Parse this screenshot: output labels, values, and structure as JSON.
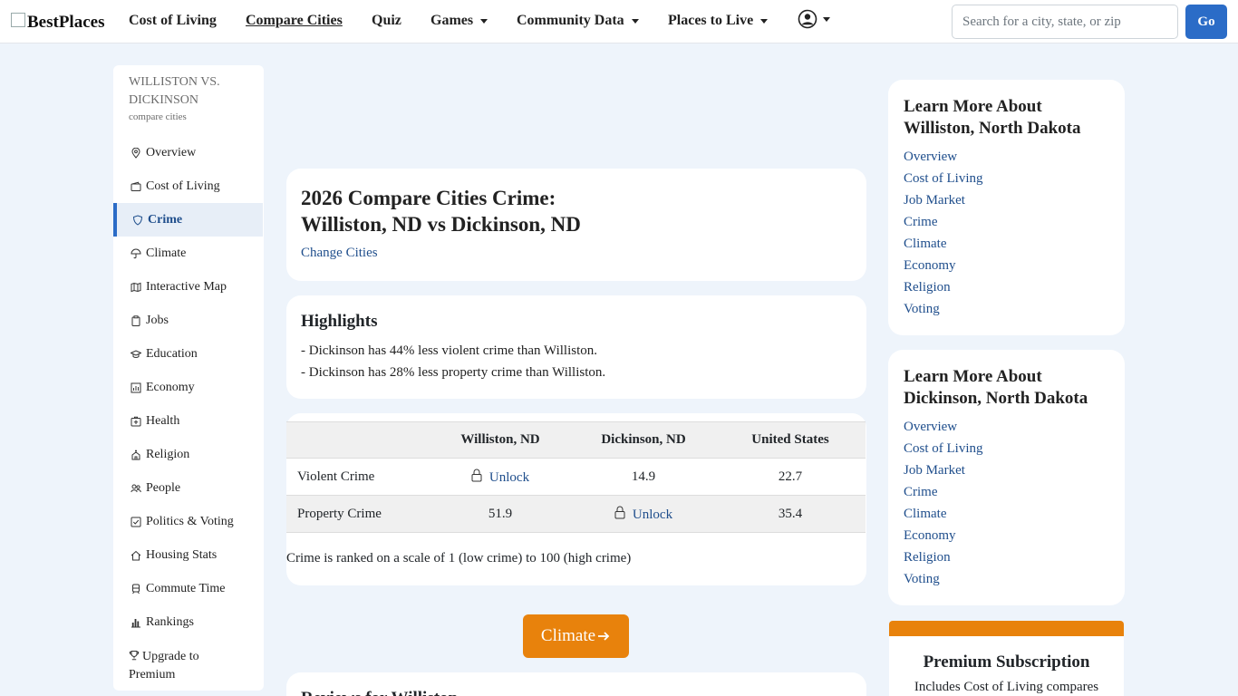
{
  "brand": {
    "name": "BestPlaces"
  },
  "nav": {
    "items": [
      "Cost of Living",
      "Compare Cities",
      "Quiz",
      "Games",
      "Community Data",
      "Places to Live"
    ],
    "active": "Compare Cities"
  },
  "search": {
    "placeholder": "Search for a city, state, or zip",
    "button": "Go"
  },
  "sidebar": {
    "heading": "WILLISTON VS. DICKINSON",
    "subheading": "compare cities",
    "items": [
      {
        "label": "Overview",
        "icon": "map-pin-icon"
      },
      {
        "label": "Cost of Living",
        "icon": "wallet-icon"
      },
      {
        "label": "Crime",
        "icon": "shield-icon"
      },
      {
        "label": "Climate",
        "icon": "umbrella-icon"
      },
      {
        "label": "Interactive Map",
        "icon": "map-icon"
      },
      {
        "label": "Jobs",
        "icon": "clipboard-icon"
      },
      {
        "label": "Education",
        "icon": "graduation-cap-icon"
      },
      {
        "label": "Economy",
        "icon": "bar-chart-icon"
      },
      {
        "label": "Health",
        "icon": "first-aid-icon"
      },
      {
        "label": "Religion",
        "icon": "church-icon"
      },
      {
        "label": "People",
        "icon": "people-icon"
      },
      {
        "label": "Politics & Voting",
        "icon": "checkbox-icon"
      },
      {
        "label": "Housing Stats",
        "icon": "house-icon"
      },
      {
        "label": "Commute Time",
        "icon": "train-icon"
      },
      {
        "label": "Rankings",
        "icon": "rankings-icon"
      },
      {
        "label": "Upgrade to Premium",
        "icon": "trophy-icon"
      }
    ],
    "active": "Crime"
  },
  "main": {
    "title_line1": "2026 Compare Cities Crime:",
    "title_line2": "Williston, ND vs Dickinson, ND",
    "change_cities": "Change Cities",
    "highlights": {
      "heading": "Highlights",
      "lines": [
        "- Dickinson has 44% less violent crime than Williston.",
        "- Dickinson has 28% less property crime than Williston."
      ]
    },
    "table": {
      "columns": [
        "",
        "Williston, ND",
        "Dickinson, ND",
        "United States"
      ],
      "rows": [
        {
          "label": "Violent Crime",
          "williston": "Unlock",
          "dickinson": "14.9",
          "us": "22.7"
        },
        {
          "label": "Property Crime",
          "williston": "51.9",
          "dickinson": "Unlock",
          "us": "35.4"
        }
      ]
    },
    "scale_note": "Crime is ranked on a scale of 1 (low crime) to 100 (high crime)",
    "next_button": "Climate",
    "reviews_heading": "Reviews for Williston"
  },
  "right": {
    "williston": {
      "heading": "Learn More About Williston, North Dakota",
      "links": [
        "Overview",
        "Cost of Living",
        "Job Market",
        "Crime",
        "Climate",
        "Economy",
        "Religion",
        "Voting"
      ]
    },
    "dickinson": {
      "heading": "Learn More About Dickinson, North Dakota",
      "links": [
        "Overview",
        "Cost of Living",
        "Job Market",
        "Crime",
        "Climate",
        "Economy",
        "Religion",
        "Voting"
      ]
    },
    "premium": {
      "heading": "Premium Subscription",
      "text": "Includes Cost of Living compares"
    }
  },
  "colors": {
    "accent": "#2b6cc7",
    "orange": "#e8820c",
    "background": "#eef4fb"
  }
}
